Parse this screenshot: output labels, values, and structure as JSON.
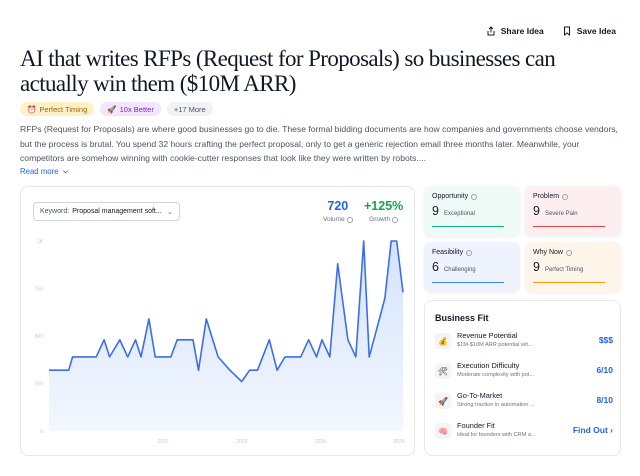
{
  "actions": {
    "share": "Share Idea",
    "save": "Save Idea"
  },
  "title": "AI that writes RFPs (Request for Proposals) so businesses can actually win them ($10M ARR)",
  "tags": [
    {
      "icon": "alarm-clock-icon",
      "label": "Perfect Timing"
    },
    {
      "icon": "rocket-icon",
      "label": "10x Better"
    },
    {
      "label": "+17 More"
    }
  ],
  "description": "RFPs (Request for Proposals) are where good businesses go to die. These formal bidding documents are how companies and governments choose vendors, but the process is brutal. You spend 32 hours crafting the perfect proposal, only to get a generic rejection email three months later. Meanwhile, your competitors are somehow winning with cookie-cutter responses that look like they were written by robots....",
  "read_more": "Read more",
  "keyword": {
    "label": "Keyword:",
    "value": "Proposal management soft..."
  },
  "stats": {
    "volume": {
      "value": "720",
      "label": "Volume"
    },
    "growth": {
      "value": "+125%",
      "label": "Growth"
    }
  },
  "chart_data": {
    "type": "area",
    "y_ticks": [
      "0",
      "250",
      "500",
      "750",
      "1K"
    ],
    "x_ticks": [
      "2022",
      "2023",
      "2024",
      "2025"
    ],
    "ylim": [
      0,
      1000
    ],
    "xlim": [
      2021.05,
      2025.55
    ],
    "grid": false,
    "series": [
      {
        "values": [
          [
            2021.05,
            320
          ],
          [
            2021.3,
            320
          ],
          [
            2021.35,
            390
          ],
          [
            2021.65,
            390
          ],
          [
            2021.75,
            480
          ],
          [
            2021.82,
            390
          ],
          [
            2021.95,
            480
          ],
          [
            2022.05,
            390
          ],
          [
            2022.15,
            480
          ],
          [
            2022.22,
            390
          ],
          [
            2022.32,
            590
          ],
          [
            2022.4,
            390
          ],
          [
            2022.6,
            390
          ],
          [
            2022.68,
            480
          ],
          [
            2022.78,
            480
          ],
          [
            2022.88,
            480
          ],
          [
            2022.95,
            320
          ],
          [
            2023.05,
            590
          ],
          [
            2023.2,
            390
          ],
          [
            2023.35,
            320
          ],
          [
            2023.5,
            260
          ],
          [
            2023.6,
            320
          ],
          [
            2023.7,
            320
          ],
          [
            2023.85,
            480
          ],
          [
            2023.95,
            320
          ],
          [
            2024.05,
            390
          ],
          [
            2024.25,
            390
          ],
          [
            2024.35,
            480
          ],
          [
            2024.45,
            390
          ],
          [
            2024.52,
            480
          ],
          [
            2024.62,
            390
          ],
          [
            2024.72,
            880
          ],
          [
            2024.85,
            480
          ],
          [
            2024.95,
            390
          ],
          [
            2025.05,
            1000
          ],
          [
            2025.12,
            390
          ],
          [
            2025.25,
            590
          ],
          [
            2025.32,
            700
          ],
          [
            2025.4,
            1000
          ],
          [
            2025.47,
            1000
          ],
          [
            2025.55,
            730
          ]
        ]
      }
    ],
    "colors": {
      "line": "#3b6ee8",
      "fill_top": "#d4e3fc",
      "fill_bottom": "#f3f7fe"
    }
  },
  "metrics": [
    {
      "title": "Opportunity",
      "score": "9",
      "label": "Exceptional",
      "bg": "#eefaf6",
      "bar": "#10b981"
    },
    {
      "title": "Problem",
      "score": "9",
      "label": "Severe Pain",
      "bg": "#fdeff0",
      "bar": "#ef4444"
    },
    {
      "title": "Feasibility",
      "score": "6",
      "label": "Challenging",
      "bg": "#eef3fd",
      "bar": "#3b82f6"
    },
    {
      "title": "Why Now",
      "score": "9",
      "label": "Perfect Timing",
      "bg": "#fdf5e9",
      "bar": "#f59e0b"
    }
  ],
  "business_fit": {
    "title": "Business Fit",
    "rows": [
      {
        "icon": "money-bag-icon",
        "name": "Revenue Potential",
        "desc": "$1M-$10M ARR potential wit...",
        "value": "$$$"
      },
      {
        "icon": "tools-icon",
        "name": "Execution Difficulty",
        "desc": "Moderate complexity with pot...",
        "value": "6/10"
      },
      {
        "icon": "rocket-icon",
        "name": "Go-To-Market",
        "desc": "Strong traction in automation ...",
        "value": "8/10"
      },
      {
        "icon": "brain-icon",
        "name": "Founder Fit",
        "desc": "Ideal for founders with CRM a...",
        "value": "Find Out"
      }
    ]
  }
}
